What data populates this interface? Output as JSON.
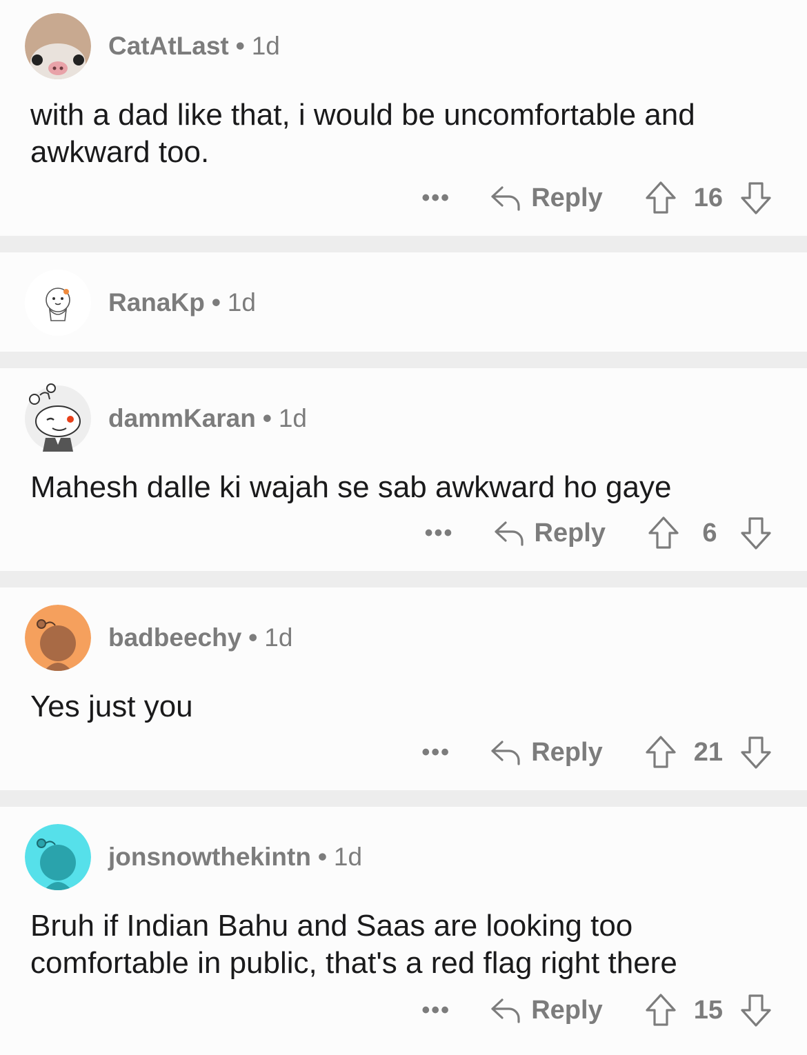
{
  "comments": [
    {
      "user": "CatAtLast",
      "age": "1d",
      "text": "with a dad like that, i would be uncomfortable and awkward too.",
      "reply_label": "Reply",
      "score": "16",
      "more": "•••",
      "avatar_color": "#c8a990"
    },
    {
      "user": "RanaKp",
      "age": "1d",
      "text": "",
      "avatar_color": "#ffffff"
    },
    {
      "user": "dammKaran",
      "age": "1d",
      "text": "Mahesh dalle ki wajah se sab awkward ho gaye",
      "reply_label": "Reply",
      "score": "6",
      "more": "•••",
      "avatar_color": "#eeeeee"
    },
    {
      "user": "badbeechy",
      "age": "1d",
      "text": "Yes just you",
      "reply_label": "Reply",
      "score": "21",
      "more": "•••",
      "avatar_color": "#f5a05d"
    },
    {
      "user": "jonsnowthekintn",
      "age": "1d",
      "text": "Bruh if Indian Bahu and Saas are looking too comfortable in public, that's a red flag right there",
      "reply_label": "Reply",
      "score": "15",
      "more": "•••",
      "avatar_color": "#56e0ea"
    }
  ],
  "separator": "•"
}
